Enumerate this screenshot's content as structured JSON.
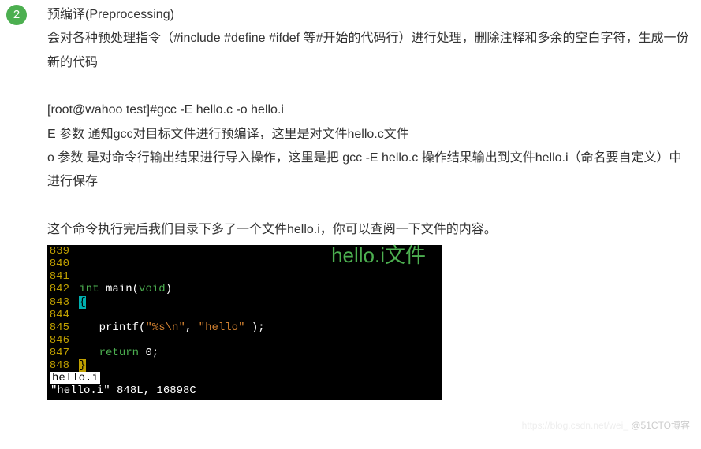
{
  "step": {
    "number": "2"
  },
  "text": {
    "title": "预编译(Preprocessing)",
    "desc": "会对各种预处理指令（#include #define #ifdef 等#开始的代码行）进行处理，删除注释和多余的空白字符，生成一份新的代码",
    "cmd": "[root@wahoo test]#gcc -E hello.c -o hello.i",
    "e_param": "E 参数 通知gcc对目标文件进行预编译，这里是对文件hello.c文件",
    "o_param": "o 参数 是对命令行输出结果进行导入操作，这里是把 gcc -E hello.c 操作结果输出到文件hello.i（命名要自定义）中进行保存",
    "after": "这个命令执行完后我们目录下多了一个文件hello.i，你可以查阅一下文件的内容。"
  },
  "terminal": {
    "title": "hello.i文件",
    "lines": [
      {
        "num": "839",
        "raw": ""
      },
      {
        "num": "840",
        "raw": ""
      },
      {
        "num": "841",
        "raw": ""
      },
      {
        "num": "842",
        "kw": "int",
        "fn": " main",
        "args": "(",
        "argkw": "void",
        "tail": ")"
      },
      {
        "num": "843",
        "cursor_cyan": "{"
      },
      {
        "num": "844",
        "raw": ""
      },
      {
        "num": "845",
        "indent": "   ",
        "call": "printf(",
        "str": "\"%s\\n\"",
        "mid": ", ",
        "str2": "\"hello\"",
        "end": " );"
      },
      {
        "num": "846",
        "raw": ""
      },
      {
        "num": "847",
        "indent": "   ",
        "ret_kw": "return",
        "ret_tail": " 0;"
      },
      {
        "num": "848",
        "cursor_yellow": "}"
      }
    ],
    "status_file": "hello.i",
    "status_info": "\"hello.i\" 848L, 16898C"
  },
  "watermark": {
    "text": "@51CTO博客",
    "faint": "https://blog.csdn.net/wei_"
  }
}
